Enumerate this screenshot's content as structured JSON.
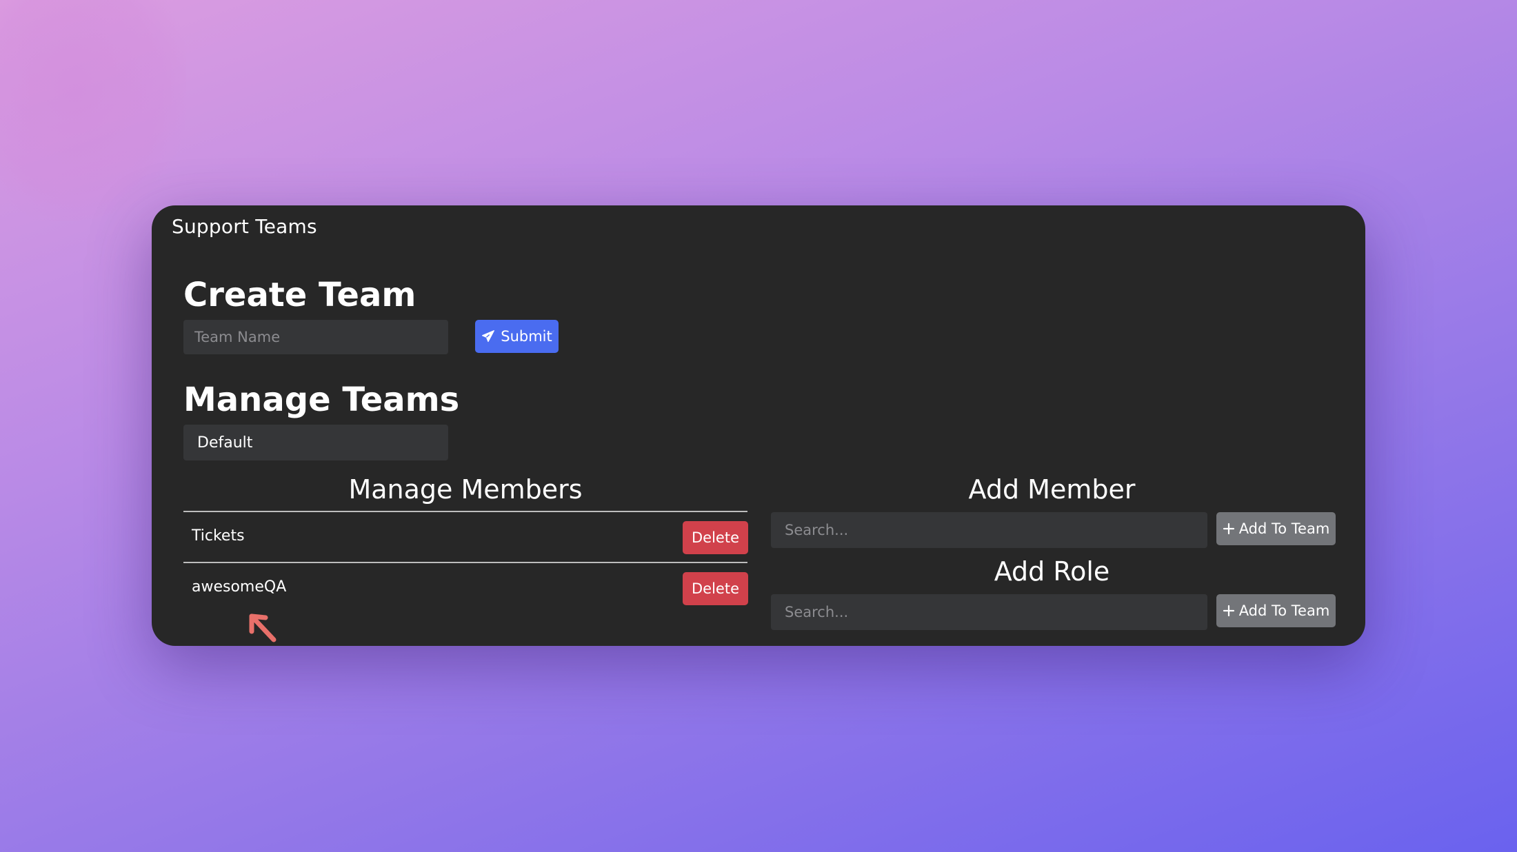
{
  "window": {
    "title": "Support Teams"
  },
  "create_team": {
    "heading": "Create Team",
    "team_name_placeholder": "Team Name",
    "submit_label": "Submit"
  },
  "manage_teams": {
    "heading": "Manage Teams",
    "selected_team": "Default"
  },
  "manage_members": {
    "heading": "Manage Members",
    "rows": [
      {
        "name": "Tickets",
        "delete_label": "Delete"
      },
      {
        "name": "awesomeQA",
        "delete_label": "Delete"
      }
    ]
  },
  "add_member": {
    "heading": "Add Member",
    "search_placeholder": "Search...",
    "button_label": "Add To Team"
  },
  "add_role": {
    "heading": "Add Role",
    "search_placeholder": "Search...",
    "button_label": "Add To Team"
  },
  "colors": {
    "primary": "#4a6cf0",
    "danger": "#d1414b",
    "secondary": "#737579",
    "panel": "#272727",
    "cursor": "#e8706a"
  }
}
